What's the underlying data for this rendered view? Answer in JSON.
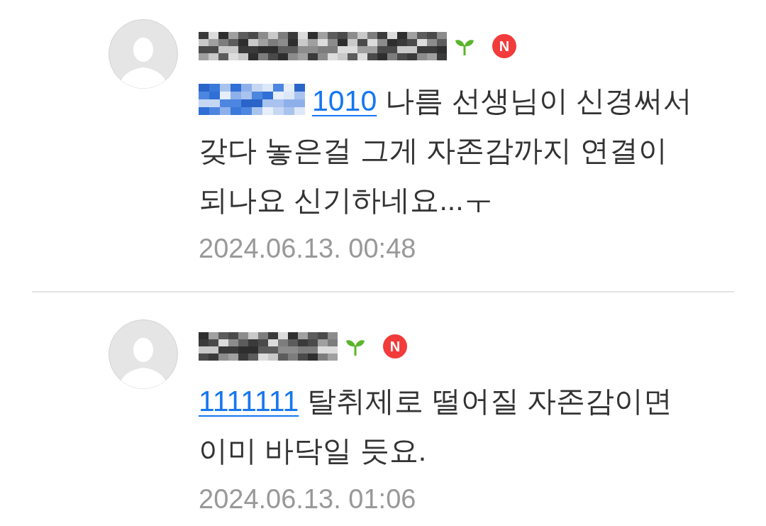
{
  "comments": [
    {
      "author": {
        "redacted": true
      },
      "badges": [
        {
          "kind": "sprout"
        },
        {
          "kind": "new",
          "label": "N"
        }
      ],
      "body": {
        "mention_redacted": true,
        "mention": "1010",
        "text": "나름 선생님이 신경써서 갖다 놓은걸 그게 자존감까지 연결이 되나요 신기하네요...ㅜ"
      },
      "date": "2024.06.13. 00:48"
    },
    {
      "author": {
        "redacted": true
      },
      "badges": [
        {
          "kind": "sprout"
        },
        {
          "kind": "new",
          "label": "N"
        }
      ],
      "body": {
        "mention_redacted": false,
        "mention": "1111111",
        "text": "탈취제로 떨어질 자존감이면 이미 바닥일 듯요."
      },
      "date": "2024.06.13. 01:06"
    }
  ]
}
